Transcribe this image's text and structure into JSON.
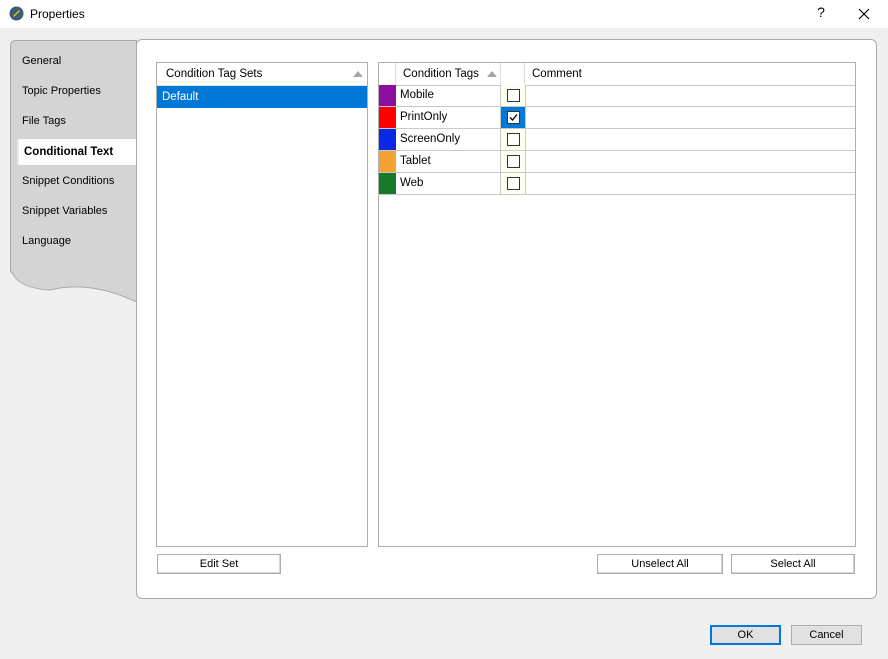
{
  "window": {
    "title": "Properties",
    "help": "?"
  },
  "tabs": [
    {
      "label": "General"
    },
    {
      "label": "Topic Properties"
    },
    {
      "label": "File Tags"
    },
    {
      "label": "Conditional Text",
      "active": true
    },
    {
      "label": "Snippet Conditions"
    },
    {
      "label": "Snippet Variables"
    },
    {
      "label": "Language"
    }
  ],
  "tag_sets": {
    "header": "Condition Tag Sets",
    "items": [
      {
        "label": "Default",
        "selected": true
      }
    ]
  },
  "tags_grid": {
    "columns": {
      "tags": "Condition Tags",
      "comment": "Comment"
    },
    "rows": [
      {
        "name": "Mobile",
        "color": "#8b0f9b",
        "checked": false,
        "comment": ""
      },
      {
        "name": "PrintOnly",
        "color": "#ff0000",
        "checked": true,
        "comment": ""
      },
      {
        "name": "ScreenOnly",
        "color": "#0a28e6",
        "checked": false,
        "comment": ""
      },
      {
        "name": "Tablet",
        "color": "#f6a230",
        "checked": false,
        "comment": ""
      },
      {
        "name": "Web",
        "color": "#177a2b",
        "checked": false,
        "comment": ""
      }
    ]
  },
  "buttons": {
    "edit_set": "Edit Set",
    "unselect_all": "Unselect All",
    "select_all": "Select All",
    "ok": "OK",
    "cancel": "Cancel"
  },
  "colors": {
    "selection": "#0078d7",
    "checkbox_bg": "#fffff0"
  }
}
